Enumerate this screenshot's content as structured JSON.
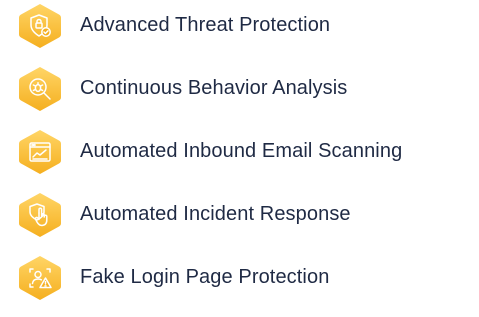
{
  "theme": {
    "accent": "#F8B92E",
    "accent_light": "#FFD566",
    "text": "#1F2A44"
  },
  "features": [
    {
      "label": "Advanced Threat Protection",
      "icon": "shield-lock-check-icon"
    },
    {
      "label": "Continuous Behavior Analysis",
      "icon": "magnifier-bug-icon"
    },
    {
      "label": "Automated Inbound Email Scanning",
      "icon": "browser-chart-icon"
    },
    {
      "label": "Automated Incident Response",
      "icon": "shield-hand-tap-icon"
    },
    {
      "label": "Fake Login Page Protection",
      "icon": "user-warning-icon"
    }
  ]
}
